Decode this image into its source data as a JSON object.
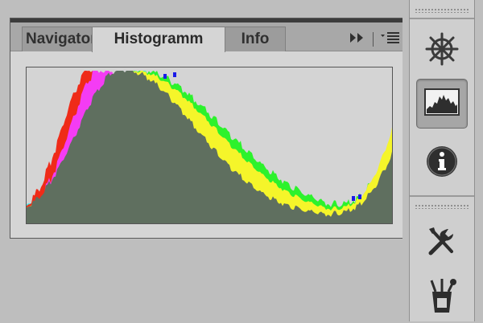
{
  "panel": {
    "tabs": [
      {
        "label": "Navigator",
        "active": false
      },
      {
        "label": "Histogramm",
        "active": true
      },
      {
        "label": "Info",
        "active": false
      }
    ],
    "toolbar_icons": [
      "expand-panels-icon",
      "panel-menu-icon"
    ]
  },
  "histogram": {
    "colors": {
      "red": "#ef2b18",
      "magenta": "#f43cf4",
      "green": "#2cf22c",
      "cyan": "#2ef2ee",
      "yellow": "#f5f52a",
      "blue": "#1a1ae8",
      "gray": "#5f6f5f",
      "background": "#d4d4d4"
    }
  },
  "dock": {
    "buttons": [
      {
        "icon": "navigator-helm-icon",
        "active": false
      },
      {
        "icon": "histogram-icon",
        "active": true
      },
      {
        "icon": "info-icon",
        "active": false
      },
      {
        "icon": "tools-icon",
        "active": false
      },
      {
        "icon": "brush-presets-icon",
        "active": false
      }
    ]
  }
}
